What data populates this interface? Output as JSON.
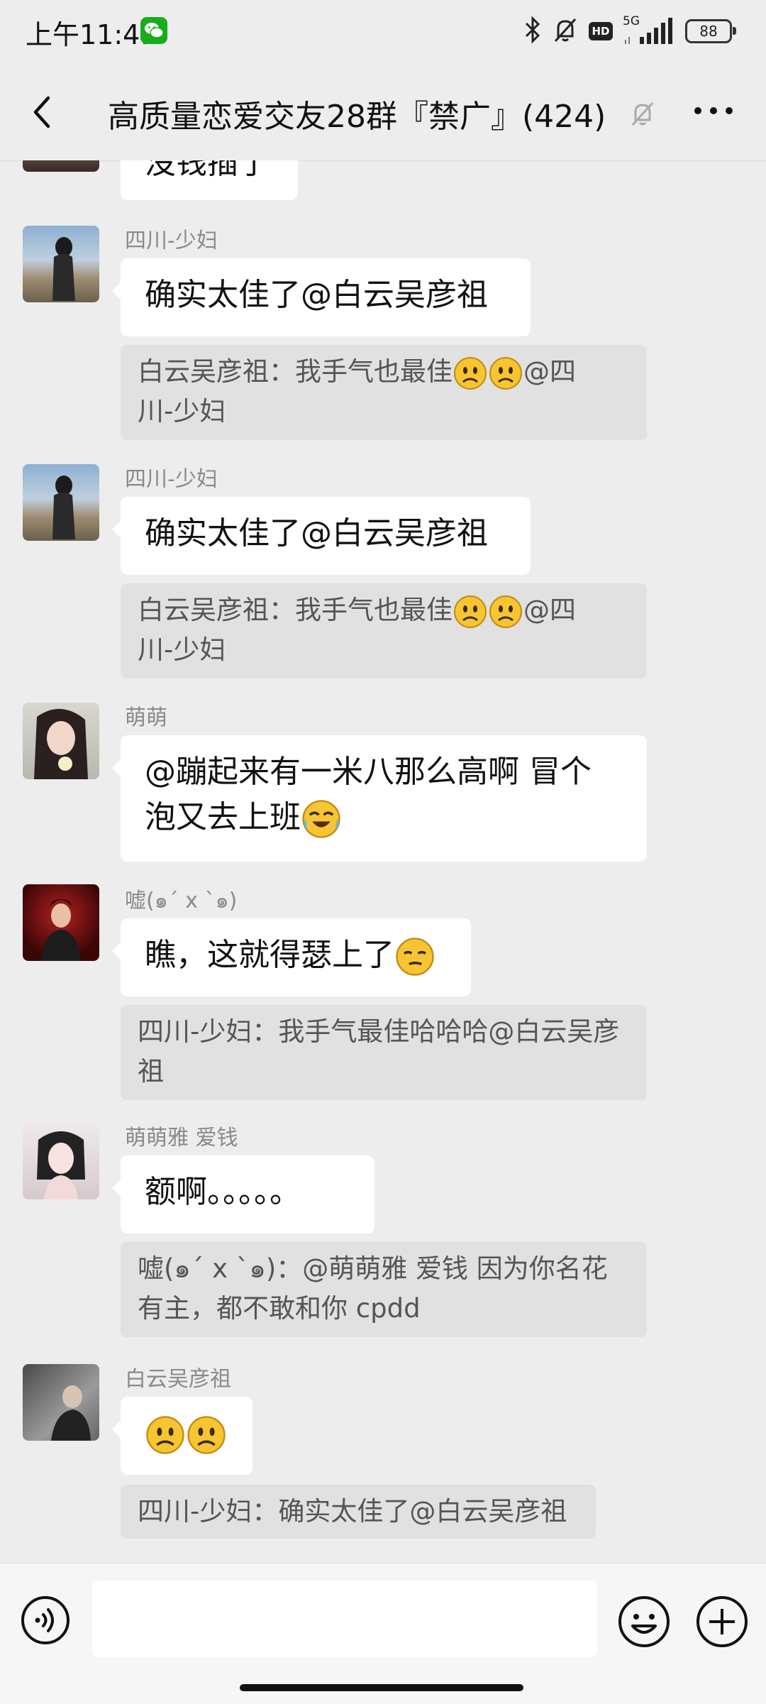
{
  "status_bar": {
    "time": "上午11:41",
    "network": "5G",
    "hd": "HD",
    "battery": "88",
    "icons": [
      "wechat-icon",
      "bluetooth-icon",
      "bell-off-icon",
      "hd-icon",
      "signal-icon",
      "battery-icon"
    ]
  },
  "header": {
    "title": "高质量恋爱交友28群『禁广』(424)",
    "icons": [
      "back-icon",
      "mute-icon",
      "more-icon"
    ]
  },
  "messages": [
    {
      "type": "partial",
      "text": "没钱插了"
    },
    {
      "type": "message",
      "sender": "四川-少妇",
      "text": "确实太佳了@白云吴彦祖",
      "quote": {
        "prefix": "白云吴彦祖：我手气也最佳",
        "suffix": "@四",
        "line2": "川-少妇"
      }
    },
    {
      "type": "message",
      "sender": "四川-少妇",
      "text": "确实太佳了@白云吴彦祖",
      "quote": {
        "prefix": "白云吴彦祖：我手气也最佳",
        "suffix": "@四",
        "line2": "川-少妇"
      }
    },
    {
      "type": "message",
      "sender": "萌萌",
      "line1": "@蹦起来有一米八那么高啊  冒个",
      "line2": "泡又去上班"
    },
    {
      "type": "message",
      "sender": "嘘(๑ˊ x ˋ๑)",
      "text": "瞧，这就得瑟上了",
      "quote": {
        "line1": "四川-少妇：我手气最佳哈哈哈@白云吴彦",
        "line2": "祖"
      }
    },
    {
      "type": "message",
      "sender": "萌萌雅 爱钱",
      "text": "额啊。。。。。",
      "quote": {
        "line1": "嘘(๑ˊ x ˋ๑)：@萌萌雅 爱钱 因为你名花",
        "line2": "有主，都不敢和你 cpdd"
      }
    },
    {
      "type": "message",
      "sender": "白云吴彦祖",
      "text": "",
      "quote": {
        "line1": "四川-少妇：确实太佳了@白云吴彦祖"
      }
    }
  ],
  "input": {
    "value": "",
    "icons": [
      "voice-icon",
      "emoji-icon",
      "plus-icon"
    ]
  },
  "colors": {
    "background": "#ededed",
    "bubble": "#ffffff",
    "quote": "#e1e1e1",
    "sender": "#8a8a8a"
  }
}
